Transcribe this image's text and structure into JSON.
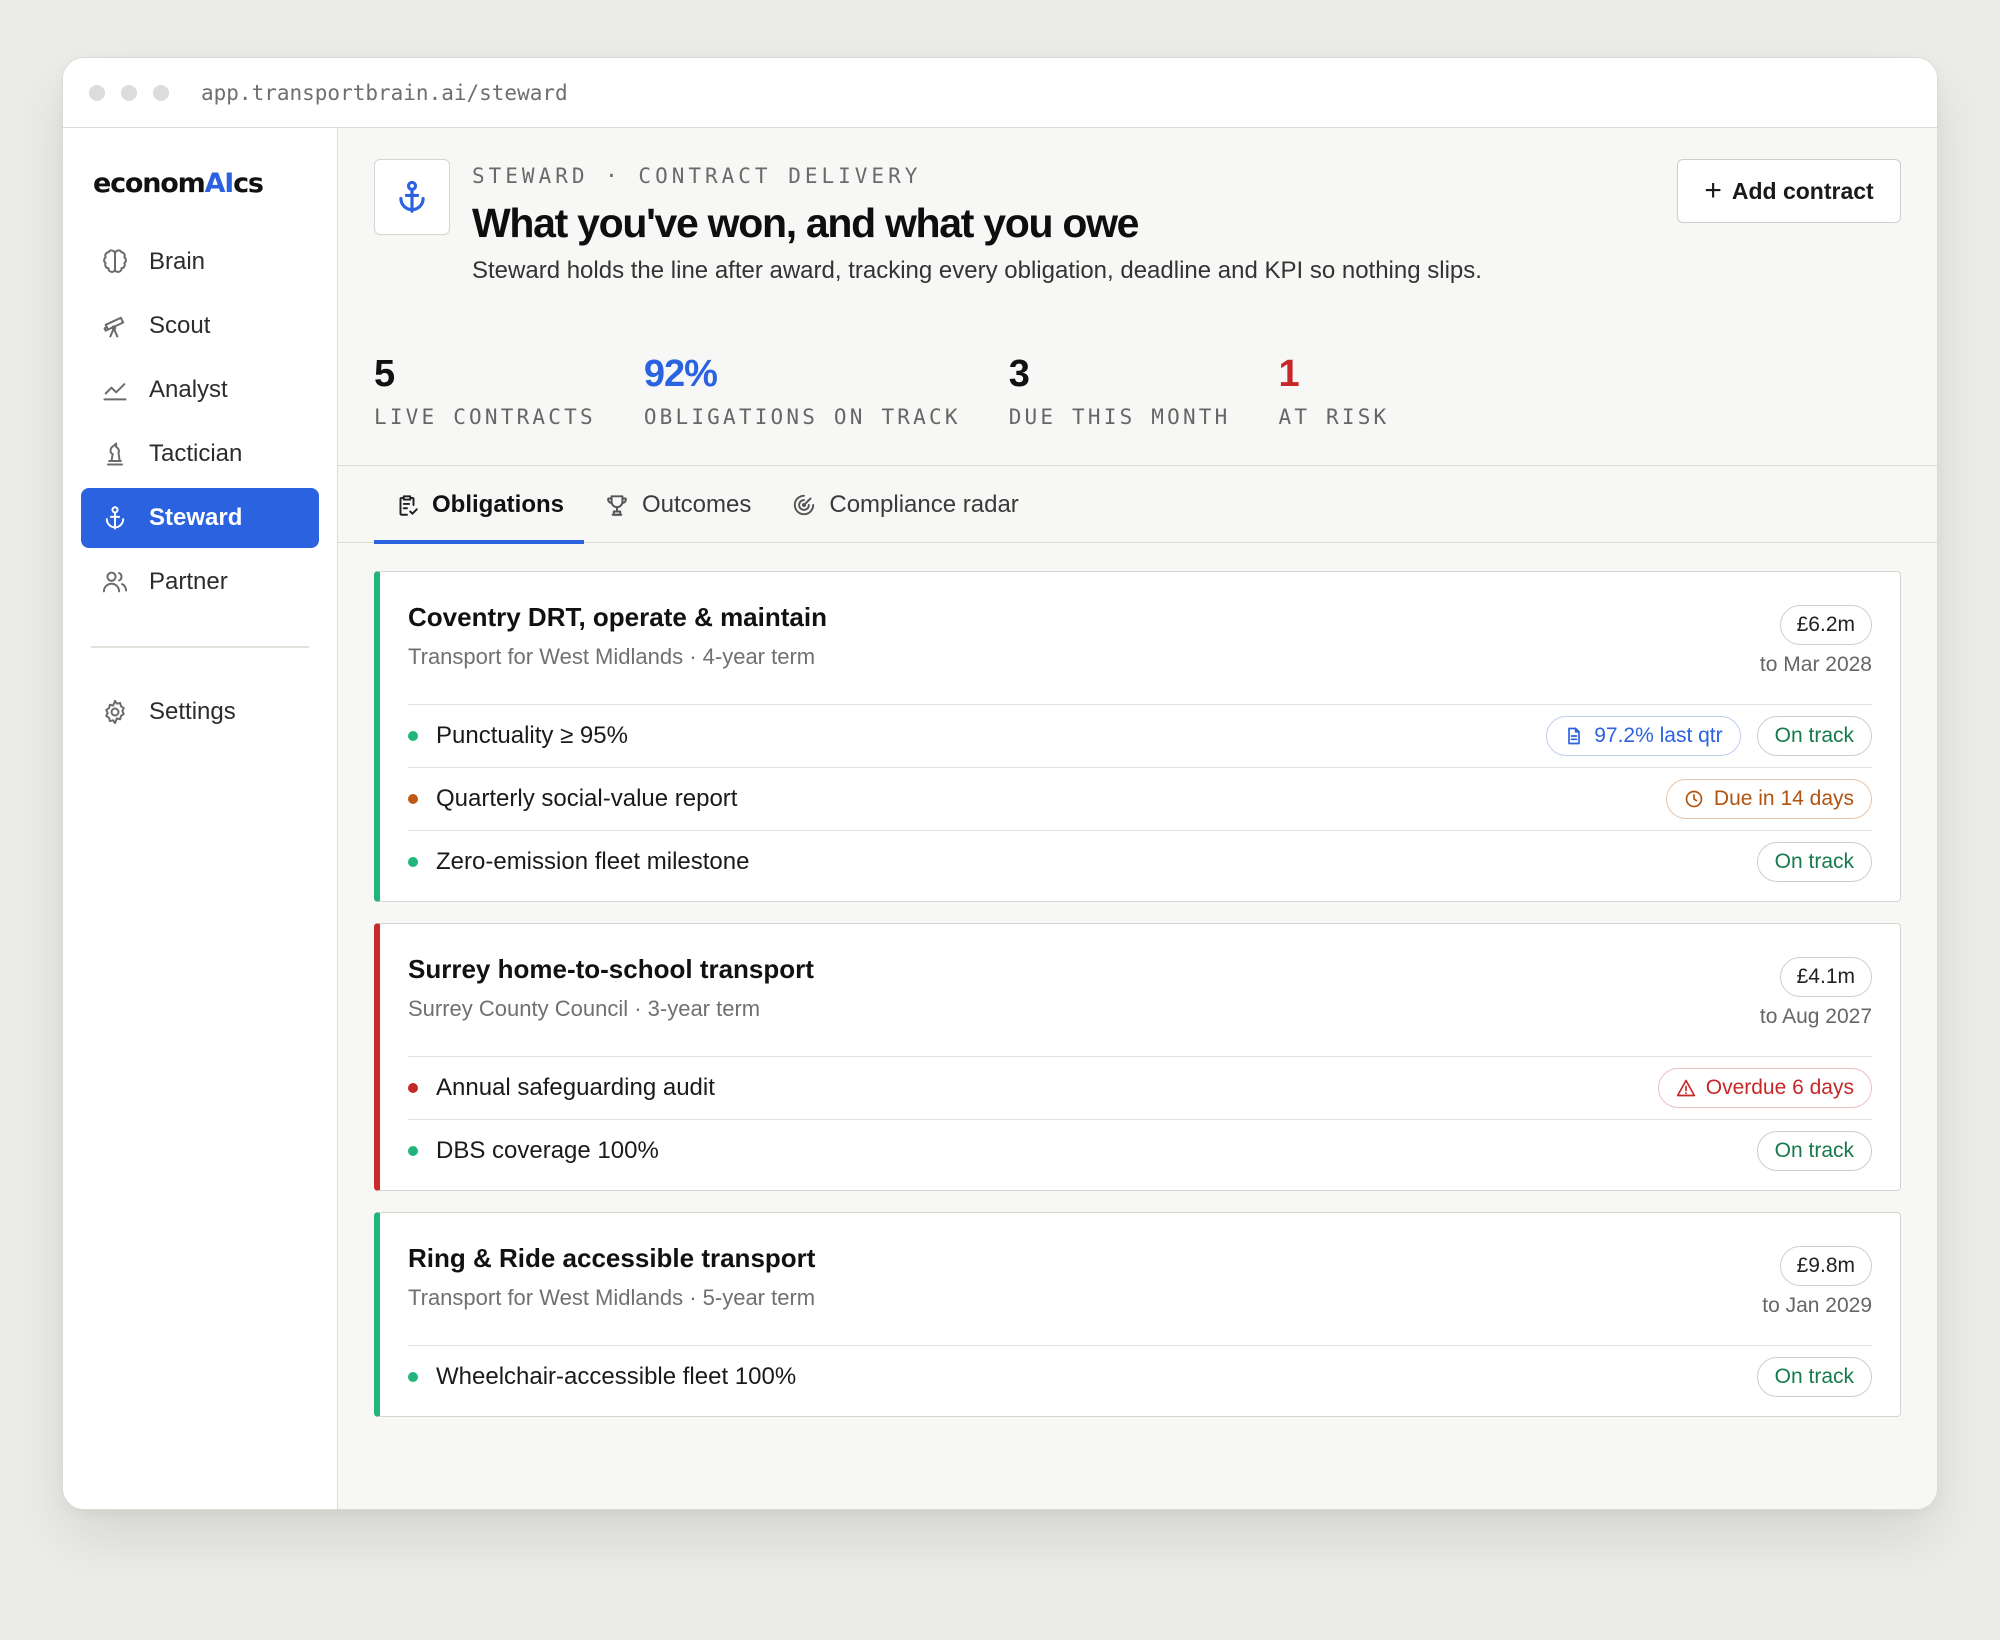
{
  "browser": {
    "url": "app.transportbrain.ai/steward"
  },
  "brand": {
    "logo_prefix": "econom",
    "logo_ai": "AI",
    "logo_suffix": "cs",
    "accent": "#2a62e0"
  },
  "sidebar": {
    "items": [
      {
        "label": "Brain",
        "icon": "brain-icon",
        "active": false
      },
      {
        "label": "Scout",
        "icon": "telescope-icon",
        "active": false
      },
      {
        "label": "Analyst",
        "icon": "chart-icon",
        "active": false
      },
      {
        "label": "Tactician",
        "icon": "chess-piece-icon",
        "active": false
      },
      {
        "label": "Steward",
        "icon": "anchor-icon",
        "active": true
      },
      {
        "label": "Partner",
        "icon": "users-icon",
        "active": false
      }
    ],
    "settings": {
      "label": "Settings",
      "icon": "gear-icon"
    }
  },
  "header": {
    "icon": "anchor-icon",
    "eyebrow": "STEWARD · CONTRACT DELIVERY",
    "title": "What you've won, and what you owe",
    "description": "Steward holds the line after award, tracking every obligation, deadline and KPI so nothing slips.",
    "add_button": "Add contract",
    "add_icon": "+"
  },
  "stats": [
    {
      "value": "5",
      "label": "LIVE CONTRACTS",
      "color": "#111111"
    },
    {
      "value": "92%",
      "label": "OBLIGATIONS ON TRACK",
      "color": "#2a62e0"
    },
    {
      "value": "3",
      "label": "DUE THIS MONTH",
      "color": "#111111"
    },
    {
      "value": "1",
      "label": "AT RISK",
      "color": "#c62828"
    }
  ],
  "tabs": [
    {
      "label": "Obligations",
      "icon": "clipboard-check-icon",
      "active": true
    },
    {
      "label": "Outcomes",
      "icon": "trophy-icon",
      "active": false
    },
    {
      "label": "Compliance radar",
      "icon": "radar-icon",
      "active": false
    }
  ],
  "contracts": [
    {
      "title": "Coventry DRT, operate & maintain",
      "subtitle": "Transport for West Midlands · 4-year term",
      "value": "£6.2m",
      "term_end": "to Mar 2028",
      "status": "healthy",
      "obligations": [
        {
          "label": "Punctuality ≥ 95%",
          "dot": "#1fb57b",
          "kpi": "97.2% last qtr",
          "status": "On track"
        },
        {
          "label": "Quarterly social-value report",
          "dot": "#c05a14",
          "status": "Due in 14 days",
          "status_kind": "due"
        },
        {
          "label": "Zero-emission fleet milestone",
          "dot": "#1fb57b",
          "status": "On track"
        }
      ]
    },
    {
      "title": "Surrey home-to-school transport",
      "subtitle": "Surrey County Council · 3-year term",
      "value": "£4.1m",
      "term_end": "to Aug 2027",
      "status": "at-risk",
      "obligations": [
        {
          "label": "Annual safeguarding audit",
          "dot": "#c62828",
          "status": "Overdue 6 days",
          "status_kind": "overdue"
        },
        {
          "label": "DBS coverage 100%",
          "dot": "#1fb57b",
          "status": "On track"
        }
      ]
    },
    {
      "title": "Ring & Ride accessible transport",
      "subtitle": "Transport for West Midlands · 5-year term",
      "value": "£9.8m",
      "term_end": "to Jan 2029",
      "status": "healthy",
      "obligations": [
        {
          "label": "Wheelchair-accessible fleet 100%",
          "dot": "#1fb57b",
          "status": "On track"
        }
      ]
    }
  ]
}
